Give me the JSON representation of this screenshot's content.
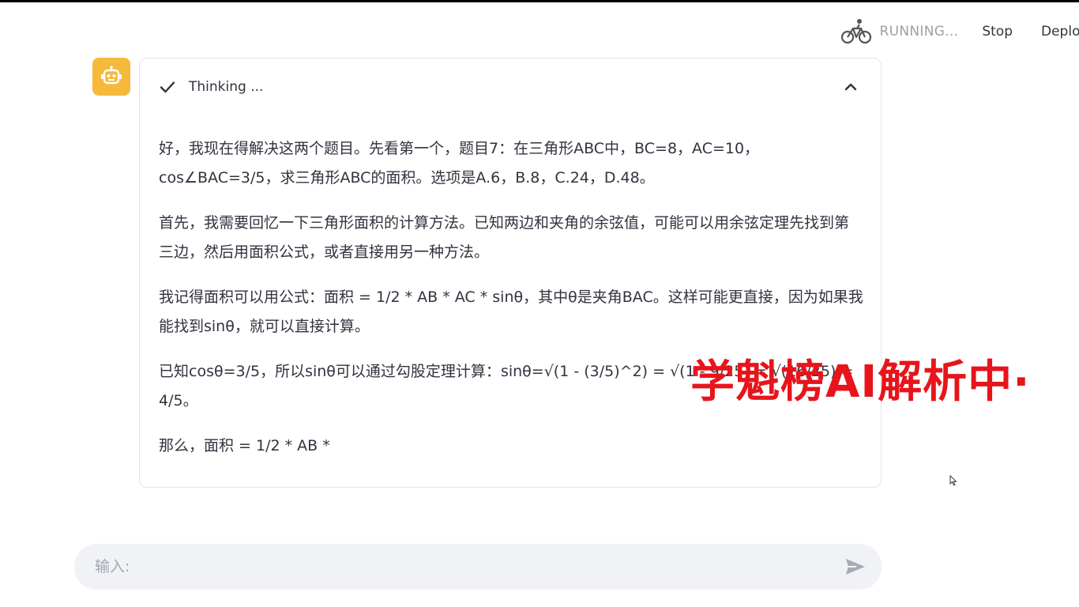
{
  "header": {
    "status_icon": "bicycle-icon",
    "status_text": "RUNNING...",
    "stop_label": "Stop",
    "deploy_label": "Deploy"
  },
  "message": {
    "avatar_icon": "robot-icon",
    "avatar_color": "#f5b93b",
    "expander": {
      "status_icon": "check-icon",
      "label": "Thinking ...",
      "toggle_icon": "chevron-up-icon"
    },
    "paragraphs": [
      "好，我现在得解决这两个题目。先看第一个，题目7：在三角形ABC中，BC=8，AC=10，cos∠BAC=3/5，求三角形ABC的面积。选项是A.6，B.8，C.24，D.48。",
      "首先，我需要回忆一下三角形面积的计算方法。已知两边和夹角的余弦值，可能可以用余弦定理先找到第三边，然后用面积公式，或者直接用另一种方法。",
      "我记得面积可以用公式：面积 = 1/2 * AB * AC * sinθ，其中θ是夹角BAC。这样可能更直接，因为如果我能找到sinθ，就可以直接计算。",
      "已知cosθ=3/5，所以sinθ可以通过勾股定理计算：sinθ=√(1 - (3/5)^2) = √(1 - 9/25) = √(16/25) = 4/5。",
      "那么，面积 = 1/2 * AB *"
    ]
  },
  "watermark": {
    "text": "学魁榜AI解析中·",
    "color": "#e8141b"
  },
  "chat_input": {
    "placeholder": "输入:",
    "value": "",
    "send_icon": "send-icon"
  }
}
